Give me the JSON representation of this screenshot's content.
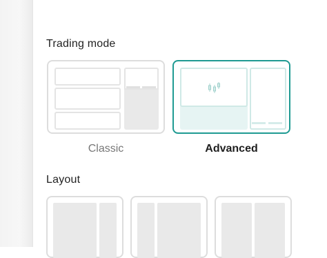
{
  "trading_mode": {
    "title": "Trading mode",
    "options": [
      {
        "label": "Classic",
        "selected": false
      },
      {
        "label": "Advanced",
        "selected": true
      }
    ]
  },
  "layout": {
    "title": "Layout",
    "options": [
      {
        "name": "layout-option-1"
      },
      {
        "name": "layout-option-2"
      },
      {
        "name": "layout-option-3"
      }
    ]
  },
  "colors": {
    "accent": "#1e9a92",
    "accent_tint": "#e6f4f3",
    "card_border": "#dddddd",
    "placeholder": "#e9e9e9"
  },
  "icons": {
    "chart_preview": "candlestick-chart-icon"
  }
}
